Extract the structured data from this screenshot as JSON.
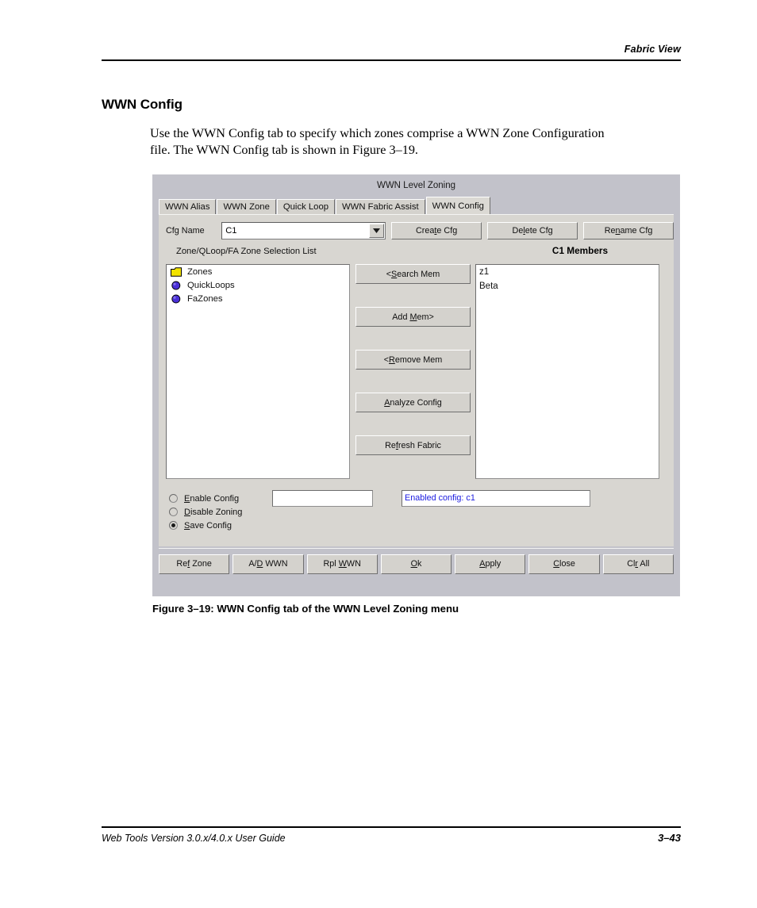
{
  "page": {
    "header_title": "Fabric View",
    "section_heading": "WWN Config",
    "paragraph": "Use the WWN Config tab to specify which zones comprise a WWN Zone Configuration file. The WWN Config tab is shown in Figure 3–19.",
    "figure_caption": "Figure 3–19:  WWN Config tab of the WWN Level Zoning menu",
    "footer_text": "Web Tools Version 3.0.x/4.0.x User Guide",
    "footer_page": "3–43"
  },
  "dialog": {
    "title": "WWN Level Zoning",
    "tabs": [
      {
        "label": "WWN Alias",
        "active": false
      },
      {
        "label": "WWN Zone",
        "active": false
      },
      {
        "label": "Quick Loop",
        "active": false
      },
      {
        "label": "WWN Fabric Assist",
        "active": false
      },
      {
        "label": "WWN Config",
        "active": true
      }
    ],
    "cfg_row": {
      "label": "Cfg Name",
      "value": "C1",
      "buttons": [
        {
          "label": "Create Cfg",
          "mnemonic": "t"
        },
        {
          "label": "Delete Cfg",
          "mnemonic": "l"
        },
        {
          "label": "Rename Cfg",
          "mnemonic": "n"
        }
      ]
    },
    "selection_list": {
      "label": "Zone/QLoop/FA Zone Selection List",
      "items": [
        {
          "label": "Zones",
          "icon": "folder-icon"
        },
        {
          "label": "QuickLoops",
          "icon": "sphere-icon"
        },
        {
          "label": "FaZones",
          "icon": "sphere-icon"
        }
      ]
    },
    "members": {
      "label": "C1 Members",
      "items": [
        "z1",
        "Beta"
      ]
    },
    "transfer_buttons": [
      {
        "label": "<Search Mem",
        "mnemonic": "S"
      },
      {
        "label": "Add Mem>",
        "mnemonic": "M"
      },
      {
        "label": "<Remove Mem",
        "mnemonic": "R"
      },
      {
        "label": "Analyze Config",
        "mnemonic": "A"
      },
      {
        "label": "Refresh Fabric",
        "mnemonic": "f"
      }
    ],
    "options": {
      "radios": [
        {
          "label": "Enable Config",
          "mnemonic": "E",
          "selected": false
        },
        {
          "label": "Disable Zoning",
          "mnemonic": "D",
          "selected": false
        },
        {
          "label": "Save Config",
          "mnemonic": "S",
          "selected": true
        }
      ],
      "text_input_value": "",
      "status_text": "Enabled config: c1",
      "status_color": "#1a1ae0"
    },
    "action_buttons": [
      {
        "label": "Ref Zone",
        "mnemonic": "f"
      },
      {
        "label": "A/D WWN",
        "mnemonic": "D"
      },
      {
        "label": "Rpl WWN",
        "mnemonic": "W"
      },
      {
        "label": "Ok",
        "mnemonic": "O"
      },
      {
        "label": "Apply",
        "mnemonic": "A"
      },
      {
        "label": "Close",
        "mnemonic": "C"
      },
      {
        "label": "Clr All",
        "mnemonic": "r"
      }
    ]
  },
  "colors": {
    "dialog_frame": "#c2c2ca",
    "panel": "#d8d6d1",
    "button_face": "#d4d2cd",
    "folder_icon": "#f2e300",
    "sphere_icon": "#4a30d8"
  }
}
